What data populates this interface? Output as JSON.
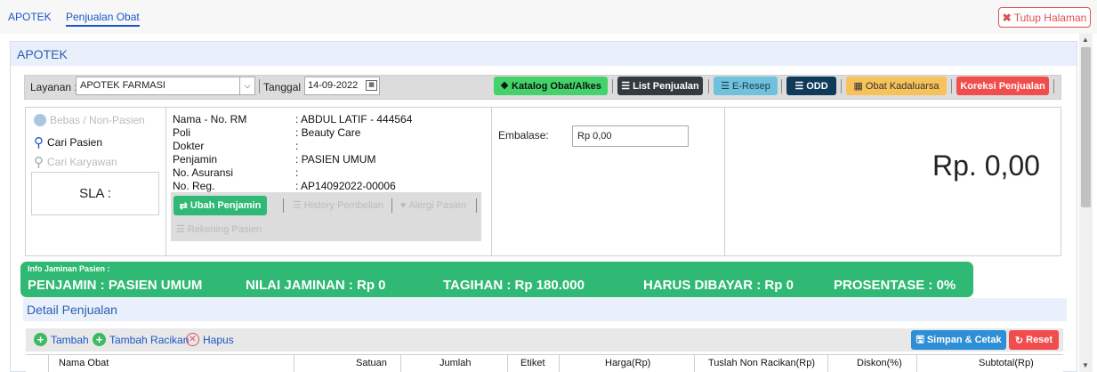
{
  "tabs": {
    "home": "APOTEK",
    "active": "Penjualan Obat",
    "close_label": "Tutup Halaman"
  },
  "panel": {
    "title": "APOTEK"
  },
  "filter": {
    "layanan_label": "Layanan :",
    "layanan_value": "APOTEK FARMASI",
    "tanggal_label": "Tanggal :",
    "tanggal_value": "14-09-2022"
  },
  "actions": {
    "katalog": "Katalog Obat/Alkes",
    "list": "List Penjualan",
    "eresep": "E-Resep",
    "odd": "ODD",
    "kadaluarsa": "Obat Kadaluarsa",
    "koreksi": "Koreksi Penjualan"
  },
  "patient_search": {
    "bebas": "Bebas / Non-Pasien",
    "cari_pasien": "Cari Pasien",
    "cari_karyawan": "Cari Karyawan",
    "sla": "SLA :"
  },
  "patient": {
    "labels": [
      "Nama - No. RM",
      "Poli",
      "Dokter",
      "Penjamin",
      "No. Asuransi",
      "No. Reg."
    ],
    "values": [
      ": ABDUL LATIF - 444564",
      ": Beauty Care",
      ":",
      ": PASIEN UMUM",
      ":",
      ": AP14092022-00006"
    ],
    "ubah_penjamin": "Ubah Penjamin",
    "history": "History Pembelian",
    "alergi": "Alergi Pasien",
    "rekening": "Rekening Pasien"
  },
  "embalase": {
    "label": "Embalase:",
    "value": "Rp 0,00"
  },
  "total": "Rp. 0,00",
  "jaminan": {
    "title": "Info Jaminan Pasien :",
    "penjamin": "PENJAMIN : PASIEN UMUM",
    "nilai": "NILAI JAMINAN : Rp 0",
    "tagihan": "TAGIHAN : Rp 180.000",
    "harus": "HARUS DIBAYAR : Rp 0",
    "prosentase": "PROSENTASE : 0%"
  },
  "detail": {
    "title": "Detail Penjualan",
    "tambah": "Tambah",
    "tambah_racikan": "Tambah Racikan",
    "hapus": "Hapus",
    "simpan": "Simpan & Cetak",
    "reset": "Reset",
    "columns": [
      "Nama Obat",
      "Satuan",
      "Jumlah",
      "Etiket",
      "Harga(Rp)",
      "Tuslah Non Racikan(Rp)",
      "Diskon(%)",
      "Subtotal(Rp)"
    ]
  },
  "colors": {
    "accent": "#1a57c7",
    "green": "#2fb974",
    "danger": "#d9534f",
    "dark": "#333a40",
    "navy": "#0f3a5a",
    "info": "#6fc1dc",
    "warning": "#f0ad4e"
  }
}
